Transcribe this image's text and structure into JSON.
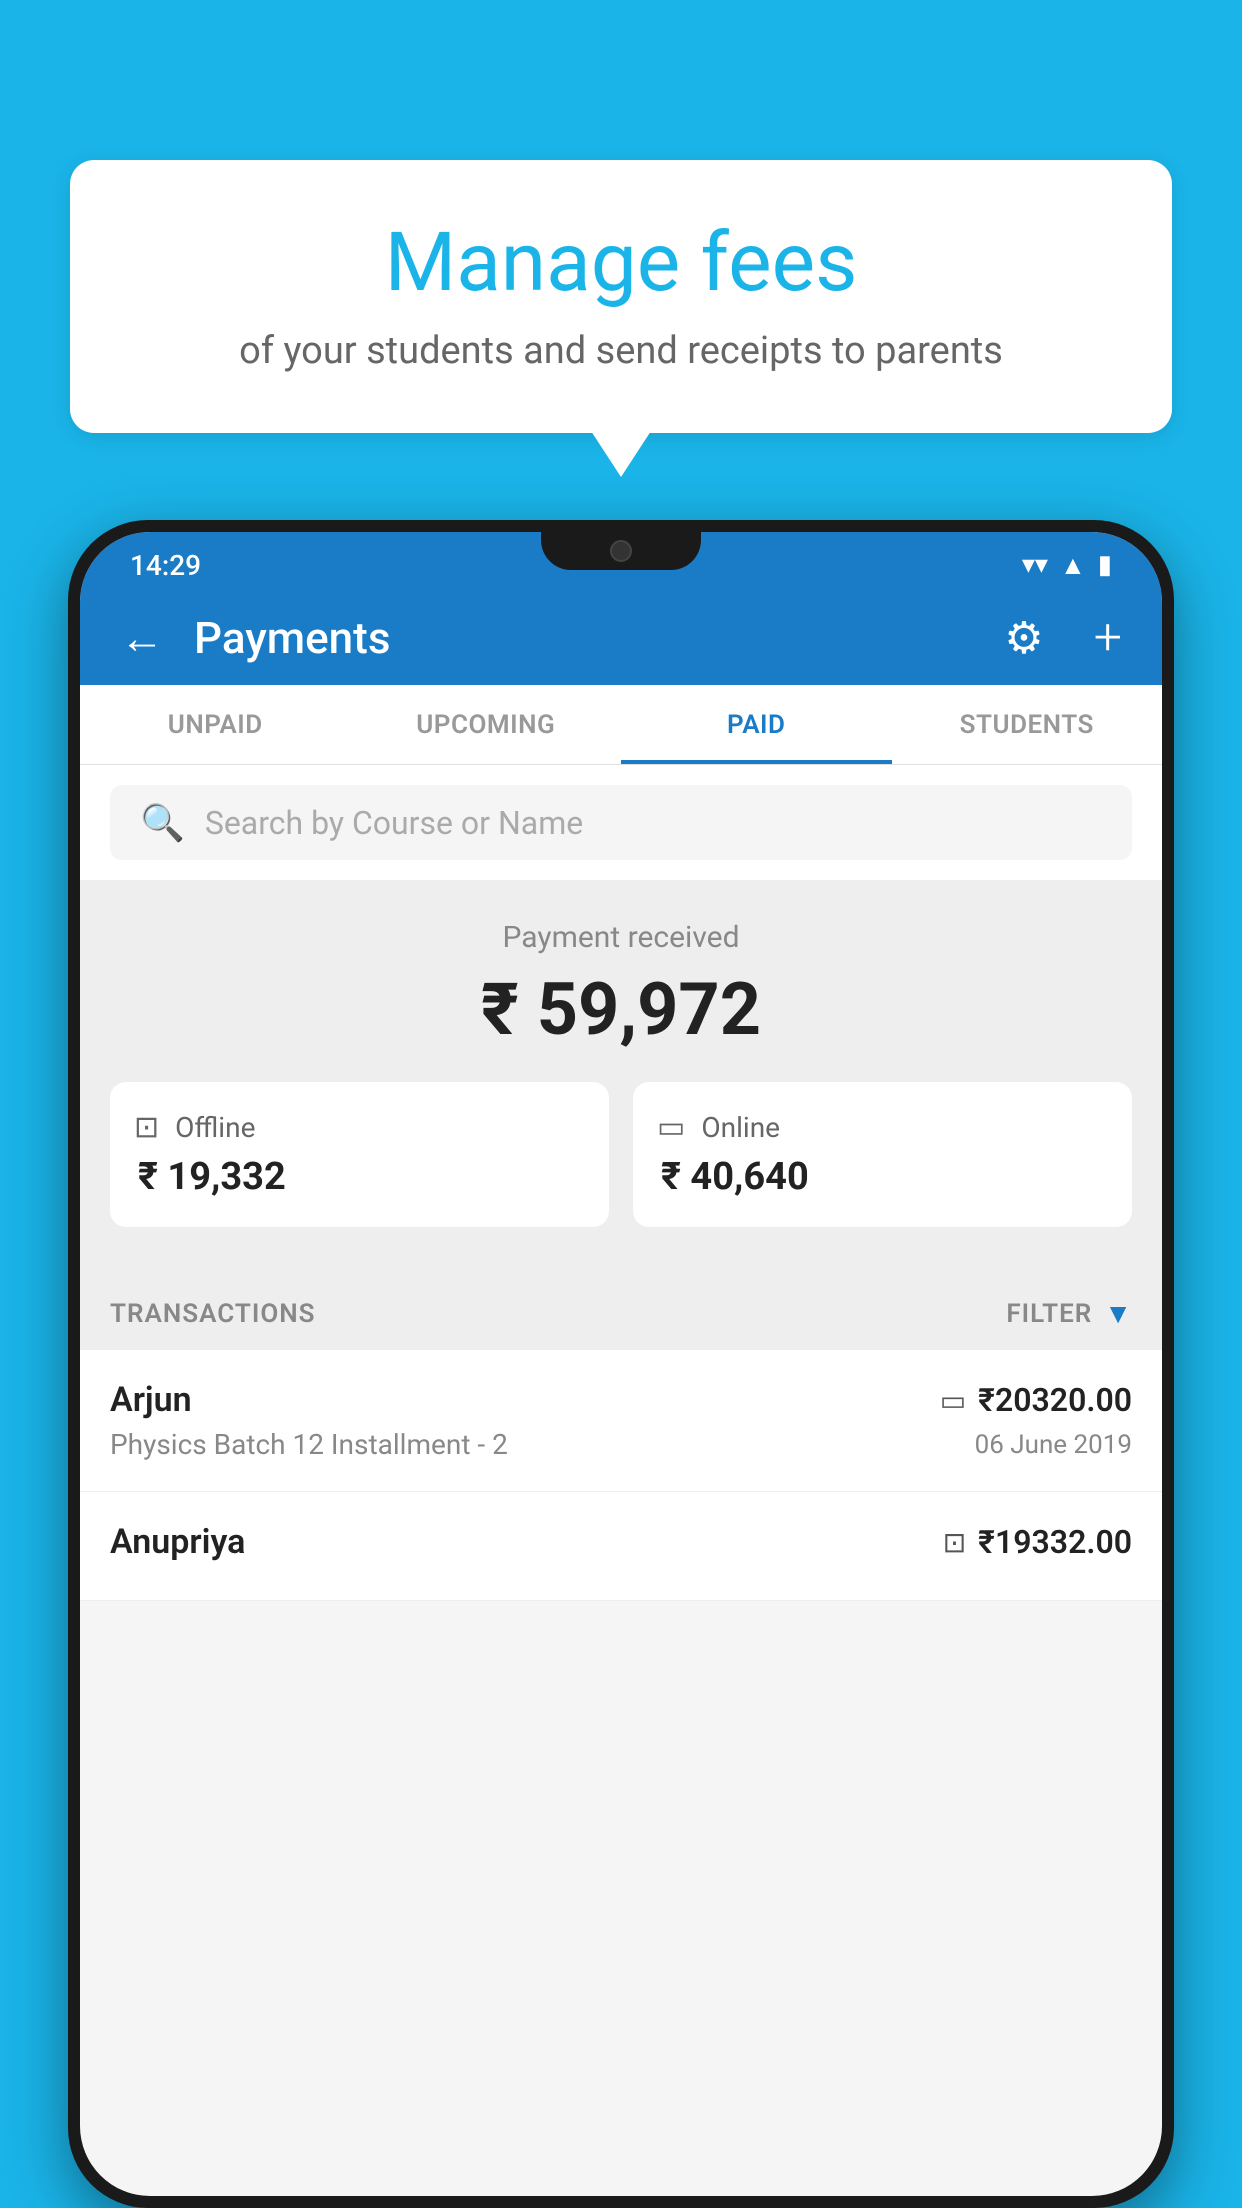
{
  "background_color": "#1ab4e8",
  "speech_bubble": {
    "title": "Manage fees",
    "subtitle": "of your students and send receipts to parents"
  },
  "status_bar": {
    "time": "14:29",
    "icons": [
      "wifi",
      "signal",
      "battery"
    ]
  },
  "app_header": {
    "title": "Payments",
    "back_label": "←",
    "gear_label": "⚙",
    "plus_label": "+"
  },
  "tabs": [
    {
      "label": "UNPAID",
      "active": false
    },
    {
      "label": "UPCOMING",
      "active": false
    },
    {
      "label": "PAID",
      "active": true
    },
    {
      "label": "STUDENTS",
      "active": false
    }
  ],
  "search": {
    "placeholder": "Search by Course or Name"
  },
  "payment_summary": {
    "label": "Payment received",
    "amount": "₹ 59,972",
    "offline": {
      "type": "Offline",
      "amount": "₹ 19,332"
    },
    "online": {
      "type": "Online",
      "amount": "₹ 40,640"
    }
  },
  "transactions": {
    "label": "TRANSACTIONS",
    "filter_label": "FILTER",
    "rows": [
      {
        "name": "Arjun",
        "course": "Physics Batch 12 Installment - 2",
        "amount": "₹20320.00",
        "date": "06 June 2019",
        "payment_type": "card"
      },
      {
        "name": "Anupriya",
        "course": "",
        "amount": "₹19332.00",
        "date": "",
        "payment_type": "offline"
      }
    ]
  }
}
